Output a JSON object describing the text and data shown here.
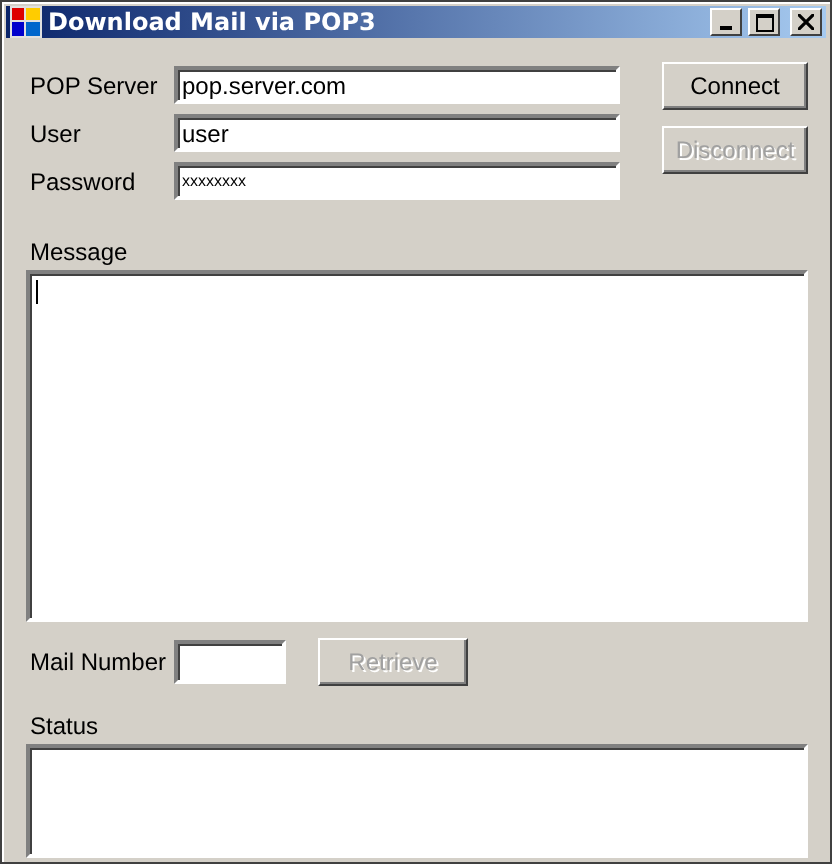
{
  "window": {
    "title": "Download Mail via POP3"
  },
  "fields": [
    {
      "label": "POP Server",
      "value": "pop.server.com",
      "kind": "text"
    },
    {
      "label": "User",
      "value": "user",
      "kind": "text"
    },
    {
      "label": "Password",
      "value": "xxxxxxxx",
      "kind": "password"
    }
  ],
  "buttons": [
    {
      "label": "Connect",
      "disabled": false
    },
    {
      "label": "Disconnect",
      "disabled": true
    }
  ],
  "message": {
    "label": "Message",
    "focused": true
  },
  "mail_number": {
    "label": "Mail Number"
  },
  "retrieve_button": {
    "label": "Retrieve",
    "disabled": true
  },
  "status": {
    "label": "Status"
  }
}
